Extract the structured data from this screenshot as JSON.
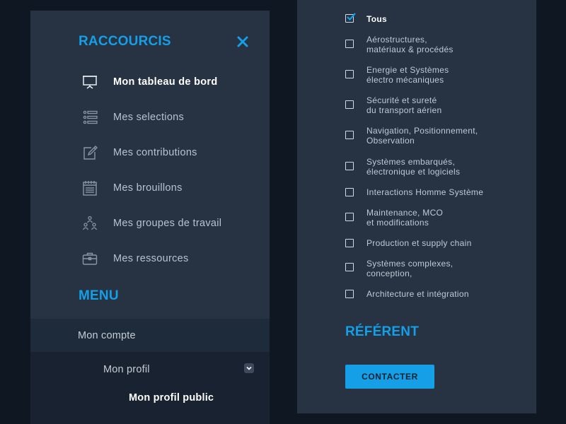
{
  "colors": {
    "accent": "#149fe7",
    "panel": "#273243",
    "background": "#0f1723"
  },
  "shortcuts": {
    "title": "RACCOURCIS",
    "close_icon": "close-icon",
    "items": [
      {
        "label": "Mon tableau de bord",
        "icon": "presentation-board-icon",
        "active": true
      },
      {
        "label": "Mes selections",
        "icon": "list-icon",
        "active": false
      },
      {
        "label": "Mes contributions",
        "icon": "edit-icon",
        "active": false
      },
      {
        "label": "Mes brouillons",
        "icon": "notepad-icon",
        "active": false
      },
      {
        "label": "Mes groupes de travail",
        "icon": "group-icon",
        "active": false
      },
      {
        "label": "Mes ressources",
        "icon": "briefcase-icon",
        "active": false
      }
    ]
  },
  "menu": {
    "title": "MENU",
    "account": "Mon compte",
    "profile": "Mon profil",
    "profile_toggle_icon": "chevron-down-icon",
    "public_profile": "Mon profil public"
  },
  "filters": {
    "items": [
      {
        "label": "Tous",
        "checked": true
      },
      {
        "label": "Aérostructures,\nmatériaux & procédés",
        "checked": false
      },
      {
        "label": "Energie et Systèmes\nélectro mécaniques",
        "checked": false
      },
      {
        "label": "Sécurité et sureté\ndu transport aérien",
        "checked": false
      },
      {
        "label": "Navigation, Positionnement,\nObservation",
        "checked": false
      },
      {
        "label": "Systèmes embarqués,\nélectronique et logiciels",
        "checked": false
      },
      {
        "label": "Interactions Homme Système",
        "checked": false
      },
      {
        "label": "Maintenance, MCO\net modifications",
        "checked": false
      },
      {
        "label": "Production et supply chain",
        "checked": false
      },
      {
        "label": "Systèmes complexes,\nconception,",
        "checked": false
      },
      {
        "label": "Architecture et intégration",
        "checked": false
      }
    ]
  },
  "referent": {
    "title": "RÉFÉRENT",
    "contact_label": "CONTACTER"
  }
}
